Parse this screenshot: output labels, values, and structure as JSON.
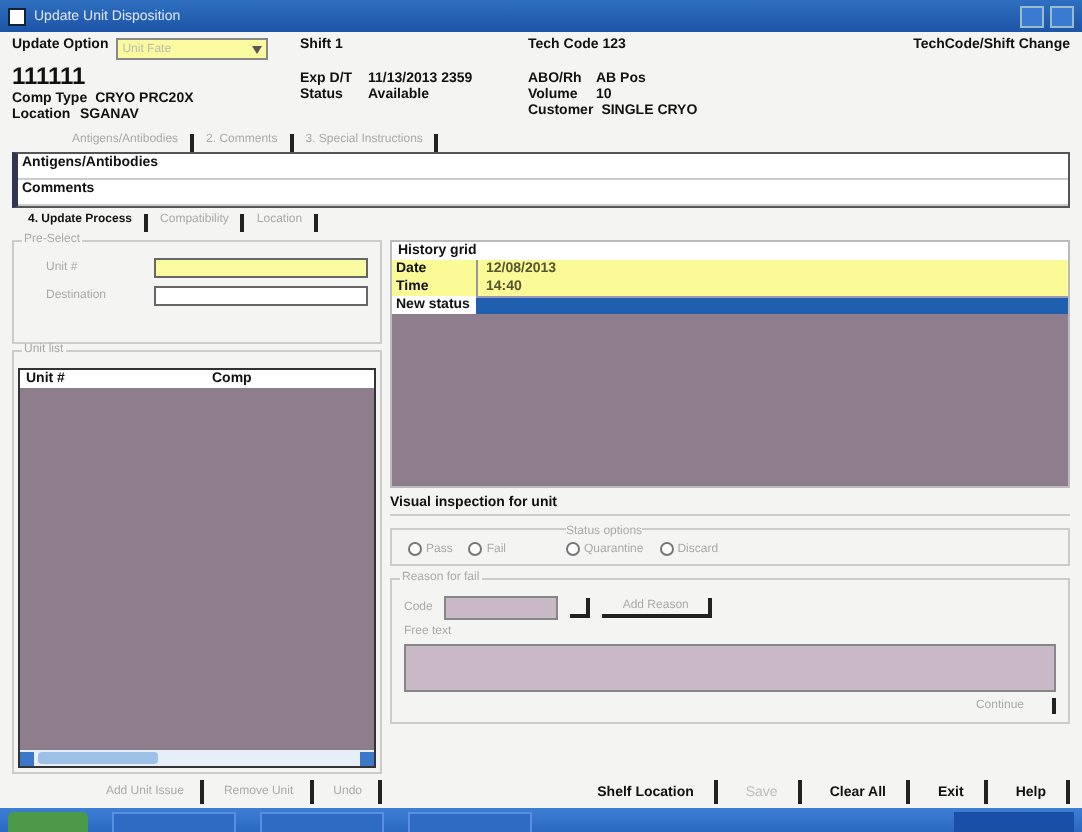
{
  "window": {
    "title": "Update Unit Disposition"
  },
  "header": {
    "update_option": {
      "label": "Update Option",
      "value": "Unit Fate"
    },
    "unit_number": "111111",
    "comp_type": {
      "label": "Comp Type",
      "value": "CRYO PRC20X"
    },
    "location": {
      "label": "Location",
      "value": "SGANAV"
    },
    "shift": "Shift 1",
    "tech_code": "Tech Code 123",
    "exp": {
      "label": "Exp D/T",
      "value": "11/13/2013 2359"
    },
    "status": {
      "label": "Status",
      "value": "Available"
    },
    "abo": {
      "label": "ABO/Rh",
      "value": "AB Pos"
    },
    "volume": {
      "label": "Volume",
      "value": "10"
    },
    "customer": {
      "label": "Customer",
      "value": "SINGLE CRYO"
    },
    "change_link": "TechCode/Shift Change"
  },
  "info_tabs": [
    {
      "label": "Antigens/Antibodies",
      "selected": false
    },
    {
      "label": "2. Comments",
      "selected": false
    },
    {
      "label": "3. Special Instructions",
      "selected": false
    }
  ],
  "info_rows": [
    "Antigens/Antibodies",
    "Comments"
  ],
  "process_tabs": [
    {
      "label": "4. Update Process",
      "selected": true
    },
    {
      "label": "Compatibility",
      "selected": false
    },
    {
      "label": "Location",
      "selected": false
    }
  ],
  "preselect": {
    "title": "Pre-Select",
    "unit_label": "Unit #",
    "destination_label": "Destination"
  },
  "unit_list": {
    "title": "Unit list",
    "columns": [
      "Unit #",
      "Comp"
    ]
  },
  "left_buttons": [
    "Add Unit Issue",
    "Remove Unit",
    "Undo"
  ],
  "history": {
    "title": "History grid",
    "rows": [
      {
        "label": "Date",
        "value": "12/08/2013"
      },
      {
        "label": "Time",
        "value": "14:40"
      }
    ],
    "new_status": "New status"
  },
  "inspection": {
    "title": "Visual inspection for unit",
    "radios": [
      {
        "label": "Pass",
        "selected": false
      },
      {
        "label": "Fail",
        "selected": false
      }
    ],
    "status_title": "Status options",
    "status_radios": [
      {
        "label": "Quarantine",
        "selected": false
      },
      {
        "label": "Discard",
        "selected": false
      }
    ],
    "reason_title": "Reason for fail",
    "code_label": "Code",
    "add_button": "Add Reason",
    "free_text_label": "Free text",
    "continue": "Continue"
  },
  "bottom_buttons": [
    {
      "label": "Shelf Location",
      "disabled": false
    },
    {
      "label": "Save",
      "disabled": true
    },
    {
      "label": "Clear All",
      "disabled": false
    },
    {
      "label": "Exit",
      "disabled": false
    },
    {
      "label": "Help",
      "disabled": false
    }
  ]
}
